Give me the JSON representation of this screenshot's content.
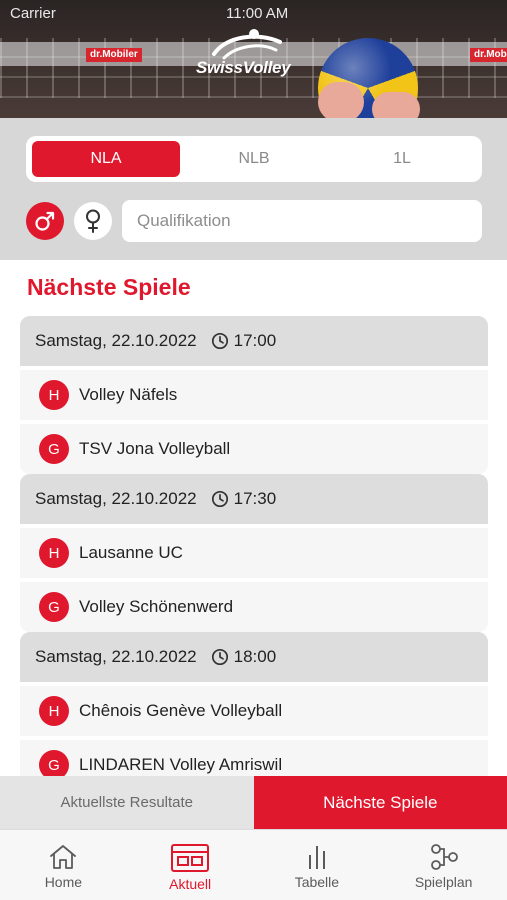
{
  "status_bar": {
    "carrier": "Carrier",
    "time": "11:00 AM"
  },
  "header": {
    "logo_text": "SwissVolley",
    "ad_boards": [
      "dr.Mobiler",
      "dr.Mobiler"
    ]
  },
  "league_tabs": [
    {
      "label": "NLA",
      "active": true
    },
    {
      "label": "NLB",
      "active": false
    },
    {
      "label": "1L",
      "active": false
    }
  ],
  "gender_filter": {
    "male_icon": "male-symbol-icon",
    "female_icon": "female-symbol-icon",
    "selected": "male"
  },
  "competition_filter": {
    "placeholder": "Qualifikation",
    "value": ""
  },
  "section_title": "Nächste Spiele",
  "games": [
    {
      "date": "Samstag, 22.10.2022",
      "time": "17:00",
      "home": "Volley Näfels",
      "guest": "TSV Jona Volleyball"
    },
    {
      "date": "Samstag, 22.10.2022",
      "time": "17:30",
      "home": "Lausanne UC",
      "guest": "Volley Schönenwerd"
    },
    {
      "date": "Samstag, 22.10.2022",
      "time": "18:00",
      "home": "Chênois Genève Volleyball",
      "guest": "LINDAREN Volley Amriswil"
    }
  ],
  "badges": {
    "home": "H",
    "guest": "G"
  },
  "segment": {
    "results_label": "Aktuellste Resultate",
    "next_label": "Nächste Spiele",
    "active": "next"
  },
  "tabbar": [
    {
      "label": "Home",
      "icon": "home-icon",
      "active": false
    },
    {
      "label": "Aktuell",
      "icon": "calendar-board-icon",
      "active": true
    },
    {
      "label": "Tabelle",
      "icon": "bar-chart-icon",
      "active": false
    },
    {
      "label": "Spielplan",
      "icon": "bracket-nodes-icon",
      "active": false
    }
  ],
  "colors": {
    "accent": "#e0182d",
    "filter_bg": "#d7d7d7",
    "date_row_bg": "#dddddd"
  }
}
